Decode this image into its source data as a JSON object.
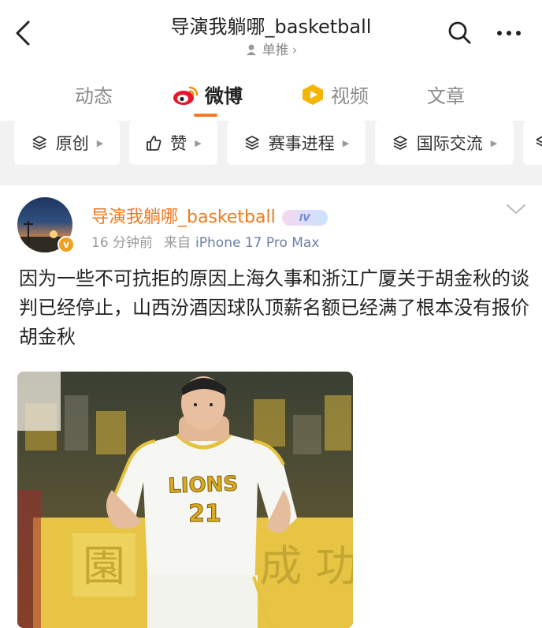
{
  "header": {
    "title": "导演我躺哪_basketball",
    "subtitle": "单推",
    "subtitle_chevron": "›",
    "icons": {
      "back": "back-arrow-icon",
      "subtitle": "person-icon",
      "search": "search-icon",
      "more": "more-icon"
    }
  },
  "tabs": [
    {
      "label": "动态",
      "active": false
    },
    {
      "label": "微博",
      "active": true,
      "icon": "weibo-logo-icon"
    },
    {
      "label": "视频",
      "active": false,
      "icon": "video-icon"
    },
    {
      "label": "文章",
      "active": false
    }
  ],
  "filters": [
    {
      "label": "原创",
      "icon": "layers-icon"
    },
    {
      "label": "赞",
      "icon": "thumb-up-icon"
    },
    {
      "label": "赛事进程",
      "icon": "layers-icon"
    },
    {
      "label": "国际交流",
      "icon": "layers-icon"
    }
  ],
  "post": {
    "author": "导演我躺哪_basketball",
    "level_badge": "IV",
    "verified_badge": "v",
    "time": "16 分钟前",
    "source_prefix": "来自",
    "source": "iPhone 17 Pro Max",
    "content": "因为一些不可抗拒的原因上海久事和浙江广厦关于胡金秋的谈判已经停止，山西汾酒因球队顶薪名额已经满了根本没有报价胡金秋",
    "image": {
      "jersey_text": "LIONS",
      "jersey_number": "21",
      "background_text_left": "園",
      "background_text_right": "成 功"
    }
  },
  "colors": {
    "accent": "#f27a25",
    "link": "#6b7fa6",
    "author": "#f2791e",
    "chip_bg": "#f2f2f2"
  }
}
